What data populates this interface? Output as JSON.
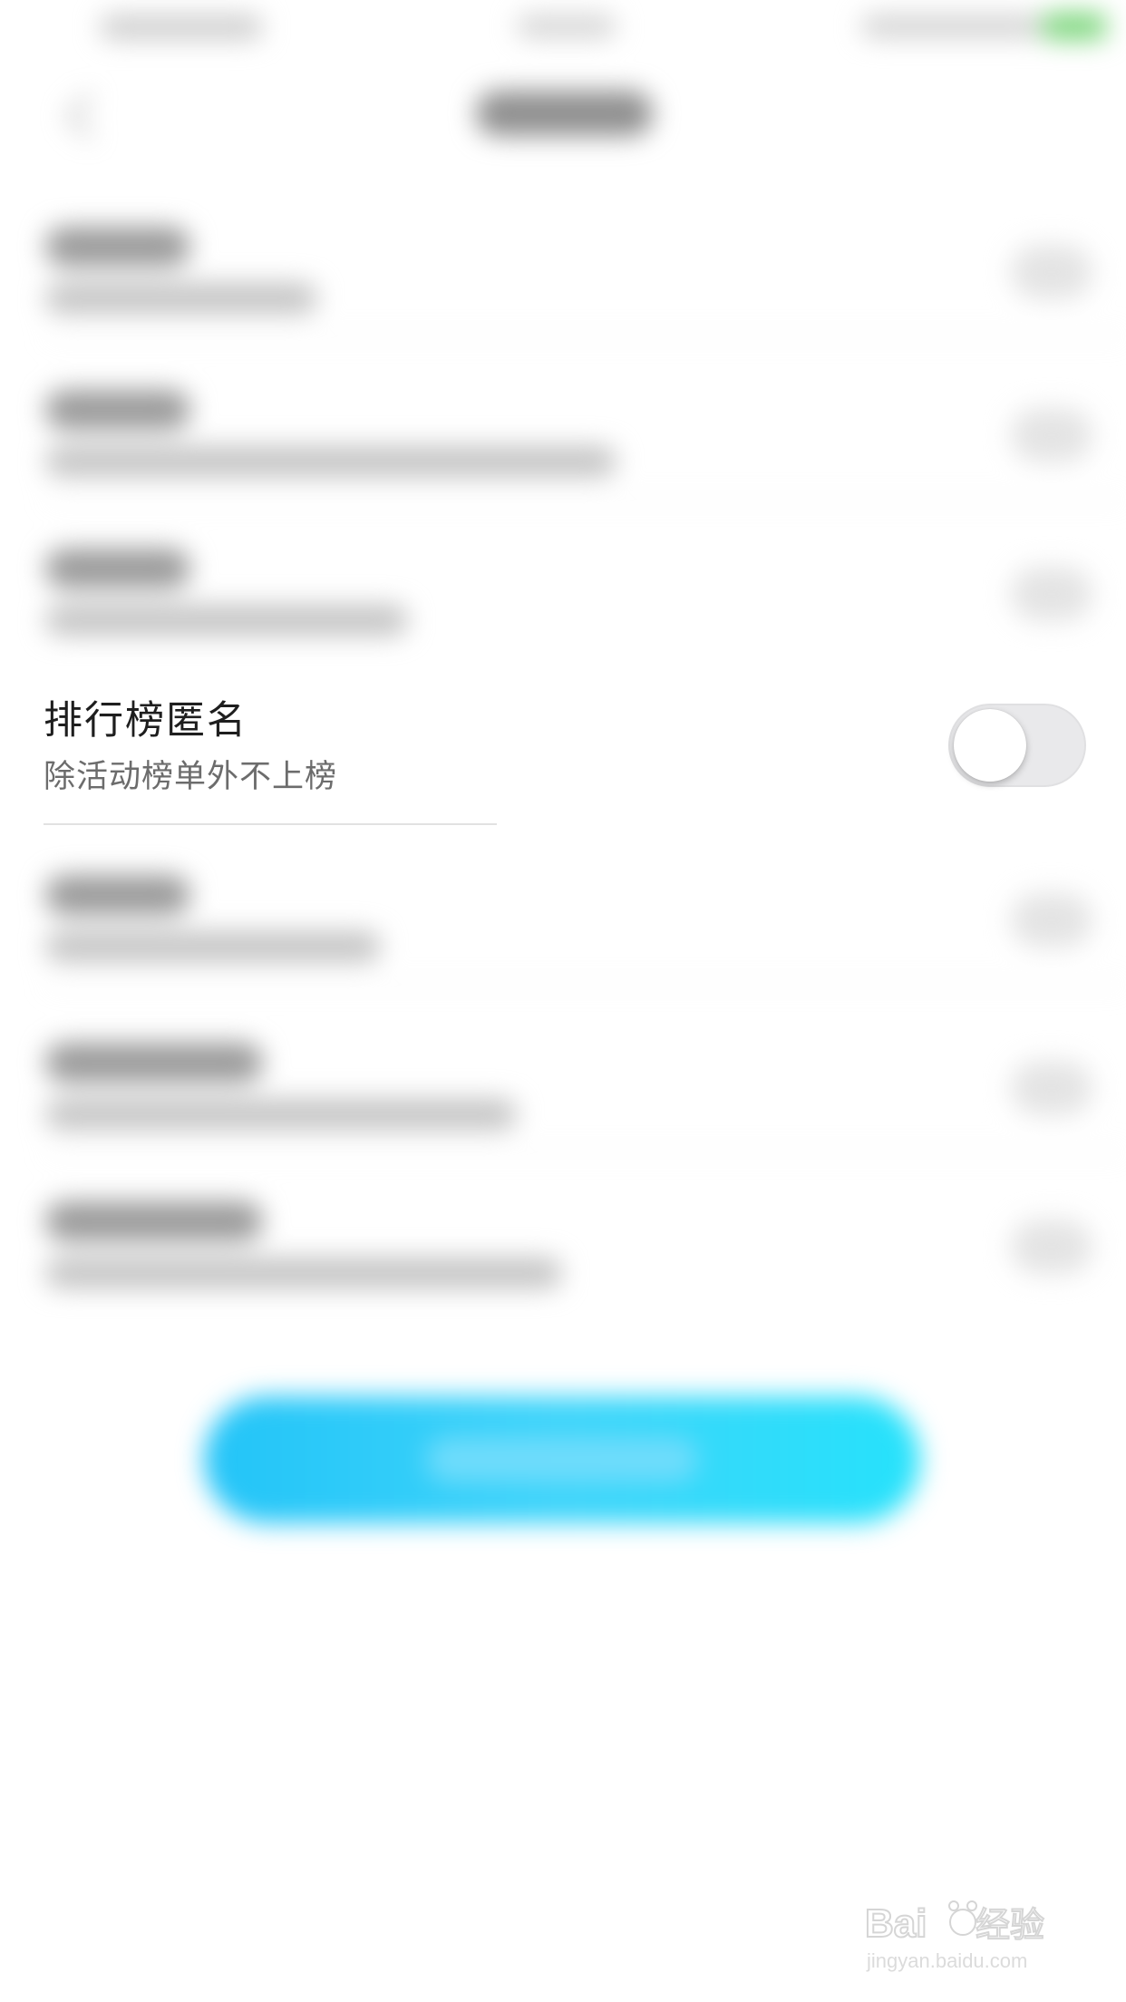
{
  "setting": {
    "title": "排行榜匿名",
    "subtitle": "除活动榜单外不上榜",
    "toggle_on": false
  },
  "colors": {
    "toggle_off": "#e9e9eb",
    "button_gradient_start": "#23c4f8",
    "button_gradient_end": "#26e2fb",
    "battery": "#7cd67c"
  },
  "watermark": {
    "brand": "Baidu经验",
    "url": "jingyan.baidu.com"
  }
}
